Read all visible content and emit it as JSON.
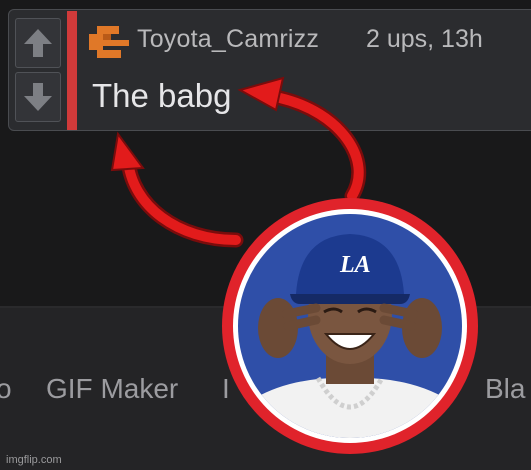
{
  "comment": {
    "username": "Toyota_Camrizz",
    "meta": "2 ups, 13h",
    "text": "The babg"
  },
  "vote": {
    "up_icon": "up-arrow-icon",
    "down_icon": "down-arrow-icon"
  },
  "nav": {
    "left_partial": "o",
    "gif_maker": "GIF Maker",
    "mid_partial": "I",
    "right_partial": "Bla"
  },
  "watermark": "imgflip.com",
  "photo": {
    "cap_logo": "LA"
  },
  "colors": {
    "accent_red": "#d03a3a",
    "avatar_orange": "#e07828",
    "arrow_red": "#e21b1b",
    "ring_red": "#e0232b",
    "photo_bg": "#2f4fa8"
  }
}
